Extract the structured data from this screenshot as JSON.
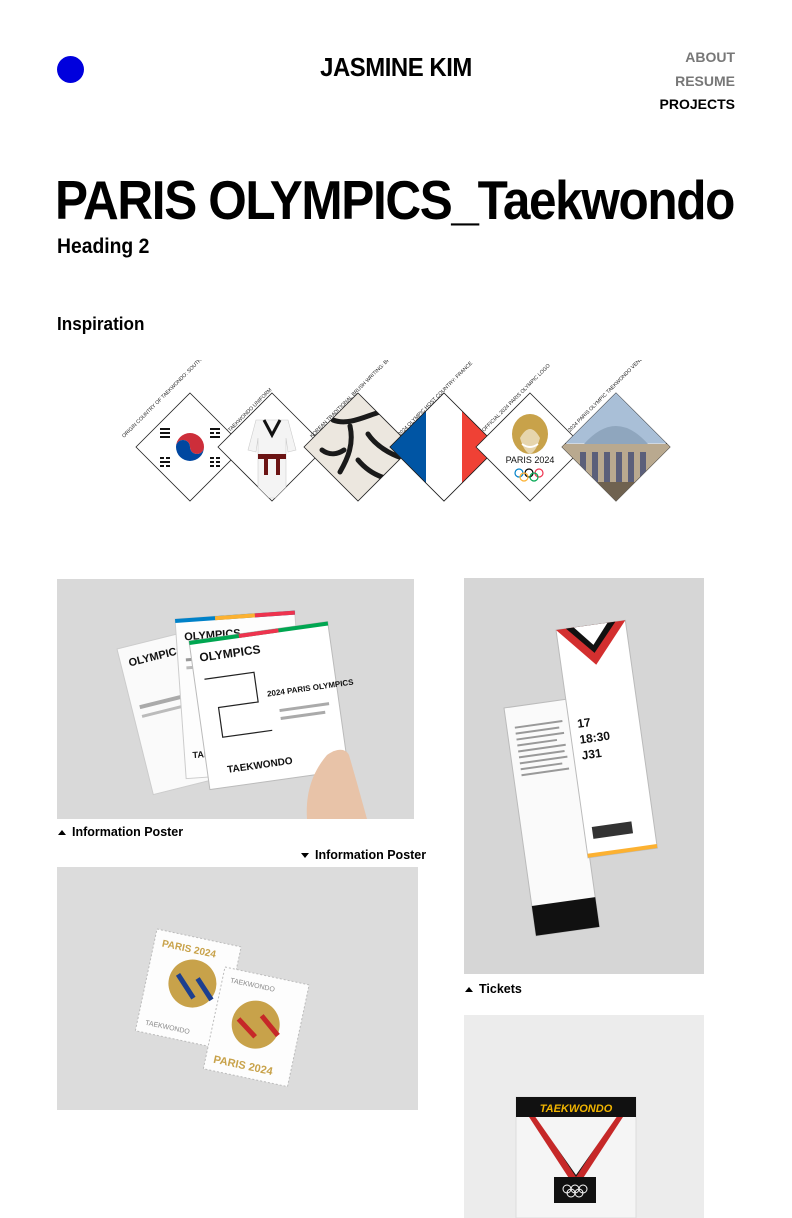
{
  "header": {
    "brand": "JASMINE KIM",
    "nav": {
      "about": "ABOUT",
      "resume": "RESUME",
      "projects": "PROJECTS"
    }
  },
  "page": {
    "title": "PARIS OLYMPICS_Taekwondo",
    "subtitle": "Heading 2",
    "inspiration_heading": "Inspiration"
  },
  "inspiration_tiles": [
    {
      "caption": "ORIGIN COUNTRY OF TAEKWONDO: SOUTH KOREA"
    },
    {
      "caption": "TAEKWONDO UNIFORM"
    },
    {
      "caption": "KOREAN TRADITIONAL BRUSH WRITING: BRUSH STROKE"
    },
    {
      "caption": "2024 OLYMPIC HOST COUNTRY: FRANCE"
    },
    {
      "caption": "OFFICIAL 2024 PARIS OLYMPIC LOGO",
      "logo_text": "PARIS 2024"
    },
    {
      "caption": "2024 PARIS OLYMPIC TAEKWONDO VENUE"
    }
  ],
  "gallery": {
    "poster": {
      "caption": "Information Poster",
      "texts": [
        "OLYMPICS",
        "OLYMPICS",
        "OLYMPICS",
        "2024 PARIS OLYMPICS",
        "TAEKWONDO",
        "TAEKWONDO"
      ]
    },
    "stamp": {
      "caption": "Information Poster",
      "texts": [
        "PARIS 2024",
        "TAEKWONDO",
        "TAEKWONDO",
        "PARIS 2024"
      ]
    },
    "tickets": {
      "caption": "Tickets",
      "texts": [
        "17",
        "18:30",
        "J31"
      ]
    },
    "package": {
      "label": "TAEKWONDO"
    }
  },
  "colors": {
    "accent_dot": "#0000dd",
    "korea_red": "#cd2e3a",
    "korea_blue": "#0047a0",
    "france_blue": "#0055a4",
    "france_red": "#ef4135",
    "belt_red": "#d32f2f",
    "gold": "#c8a24a"
  }
}
